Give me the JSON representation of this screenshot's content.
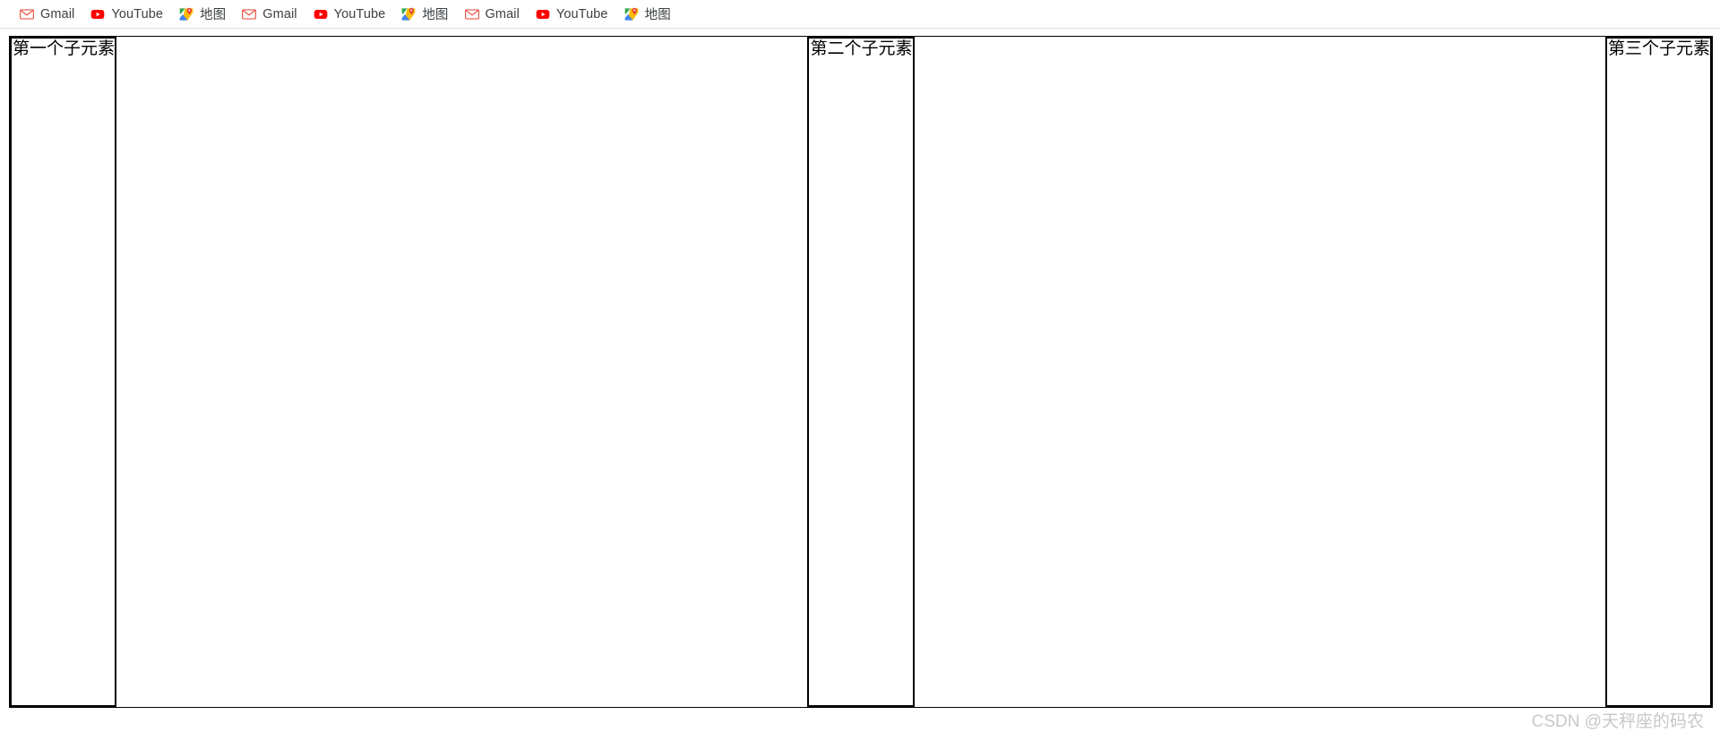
{
  "bookmarks_bar": {
    "items": [
      {
        "label": "Gmail",
        "icon": "gmail-icon"
      },
      {
        "label": "YouTube",
        "icon": "youtube-icon"
      },
      {
        "label": "地图",
        "icon": "google-maps-icon"
      },
      {
        "label": "Gmail",
        "icon": "gmail-icon"
      },
      {
        "label": "YouTube",
        "icon": "youtube-icon"
      },
      {
        "label": "地图",
        "icon": "google-maps-icon"
      },
      {
        "label": "Gmail",
        "icon": "gmail-icon"
      },
      {
        "label": "YouTube",
        "icon": "youtube-icon"
      },
      {
        "label": "地图",
        "icon": "google-maps-icon"
      }
    ]
  },
  "flex_demo": {
    "children": [
      {
        "label": "第一个子元素"
      },
      {
        "label": "第二个子元素"
      },
      {
        "label": "第三个子元素"
      }
    ]
  },
  "watermark": {
    "text": "CSDN @天秤座的码农"
  },
  "colors": {
    "gmail_red": "#EA4335",
    "youtube_red": "#FF0000",
    "maps_green": "#34A853",
    "maps_blue": "#4285F4",
    "maps_yellow": "#FBBC04",
    "maps_pin_red": "#EA4335",
    "border_black": "#000000",
    "bar_divider": "#DADCE0",
    "watermark_gray": "#C8C8C8"
  }
}
